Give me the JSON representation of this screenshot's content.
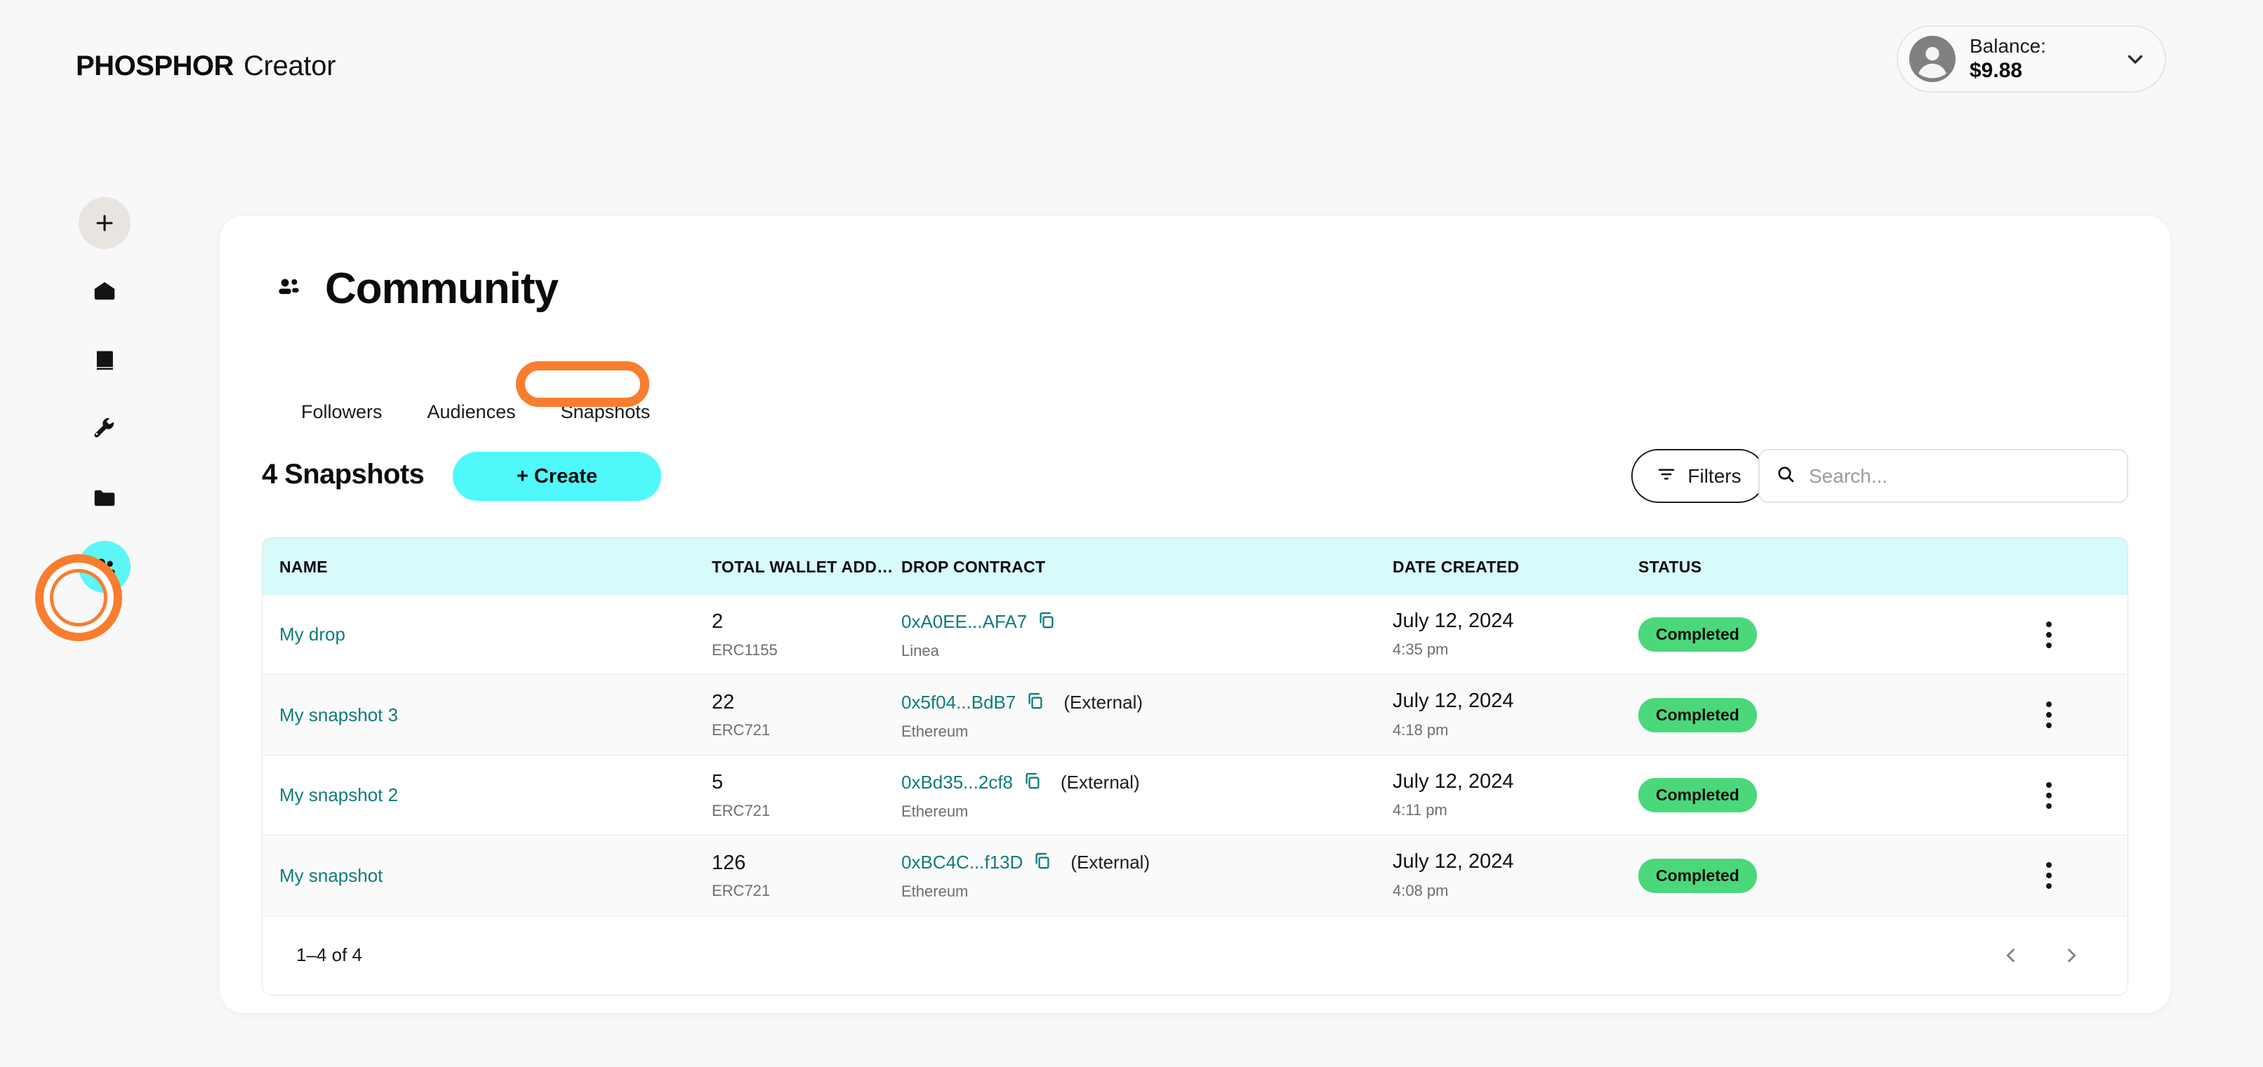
{
  "header": {
    "logo_brand": "PHOSPHOR",
    "logo_sub": "Creator",
    "balance_label": "Balance:",
    "balance_value": "$9.88"
  },
  "sidebar": {
    "items": [
      {
        "name": "add",
        "icon": "plus-icon"
      },
      {
        "name": "home",
        "icon": "pentagon-icon"
      },
      {
        "name": "library",
        "icon": "book-icon"
      },
      {
        "name": "tools",
        "icon": "wrench-icon"
      },
      {
        "name": "assets",
        "icon": "folder-icon"
      },
      {
        "name": "community",
        "icon": "people-icon",
        "active": true
      }
    ]
  },
  "main": {
    "page_title": "Community",
    "tabs": [
      {
        "label": "Followers",
        "active": false
      },
      {
        "label": "Audiences",
        "active": false
      },
      {
        "label": "Snapshots",
        "active": true
      }
    ],
    "count_title": "4 Snapshots",
    "create_label": "+ Create",
    "filters_label": "Filters",
    "search_placeholder": "Search...",
    "search_value": ""
  },
  "table": {
    "columns": [
      "NAME",
      "TOTAL WALLET ADDRE...",
      "DROP CONTRACT",
      "DATE CREATED",
      "STATUS"
    ],
    "rows": [
      {
        "name": "My drop",
        "wallets": "2",
        "token_standard": "ERC1155",
        "contract": "0xA0EE...AFA7",
        "external": "",
        "chain": "Linea",
        "date": "July 12, 2024",
        "time": "4:35 pm",
        "status": "Completed"
      },
      {
        "name": "My snapshot 3",
        "wallets": "22",
        "token_standard": "ERC721",
        "contract": "0x5f04...BdB7",
        "external": "(External)",
        "chain": "Ethereum",
        "date": "July 12, 2024",
        "time": "4:18 pm",
        "status": "Completed"
      },
      {
        "name": "My snapshot 2",
        "wallets": "5",
        "token_standard": "ERC721",
        "contract": "0xBd35...2cf8",
        "external": "(External)",
        "chain": "Ethereum",
        "date": "July 12, 2024",
        "time": "4:11 pm",
        "status": "Completed"
      },
      {
        "name": "My snapshot",
        "wallets": "126",
        "token_standard": "ERC721",
        "contract": "0xBC4C...f13D",
        "external": "(External)",
        "chain": "Ethereum",
        "date": "July 12, 2024",
        "time": "4:08 pm",
        "status": "Completed"
      }
    ],
    "pagination": "1–4 of 4"
  },
  "colors": {
    "accent_cyan": "#4FF8FA",
    "header_cyan": "#D7FAFA",
    "link_teal": "#0E7C7B",
    "status_green": "#4AD87A",
    "annotation_orange": "#F97D2E",
    "page_bg": "#F8F8F8"
  }
}
